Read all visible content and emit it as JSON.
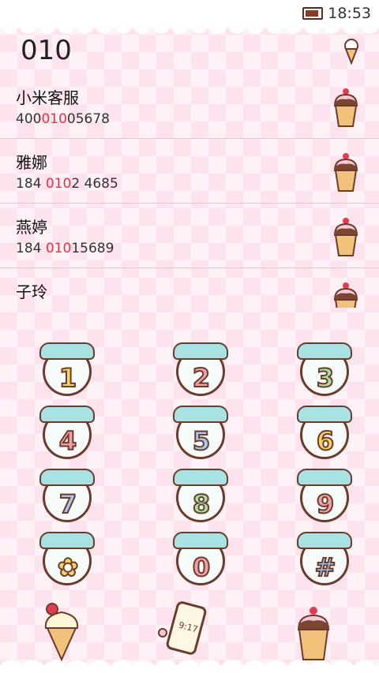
{
  "status": {
    "time": "18:53"
  },
  "dialer": {
    "input": "010"
  },
  "contacts": [
    {
      "name": "小米客服",
      "num_pre": "400",
      "num_hl": "010",
      "num_post": "05678"
    },
    {
      "name": "雅娜",
      "num_pre": "184 ",
      "num_hl": "010",
      "num_post": "2 4685"
    },
    {
      "name": "燕婷",
      "num_pre": "184 ",
      "num_hl": "010",
      "num_post": "15689"
    },
    {
      "name": "子玲",
      "num_pre": "",
      "num_hl": "",
      "num_post": ""
    }
  ],
  "keys": [
    {
      "label": "1",
      "color": "#f5d35f"
    },
    {
      "label": "2",
      "color": "#f2a0a8"
    },
    {
      "label": "3",
      "color": "#a7dea1"
    },
    {
      "label": "4",
      "color": "#f2a0a8"
    },
    {
      "label": "5",
      "color": "#a9c8ee"
    },
    {
      "label": "6",
      "color": "#f5d35f"
    },
    {
      "label": "7",
      "color": "#a9c8ee"
    },
    {
      "label": "8",
      "color": "#a7dea1"
    },
    {
      "label": "9",
      "color": "#f2a0a8"
    },
    {
      "label": "✿",
      "color": "#f5d35f"
    },
    {
      "label": "0",
      "color": "#f2a0a8"
    },
    {
      "label": "#",
      "color": "#a9c8ee"
    }
  ],
  "phone_screen": "9:17",
  "icons": {
    "header_icon": "ice-cream-cone-icon",
    "contact_icon": "ice-cream-cup-icon",
    "left_action": "soft-serve-cone-icon",
    "center_action": "phone-call-icon",
    "right_action": "ice-cream-cup-icon"
  }
}
